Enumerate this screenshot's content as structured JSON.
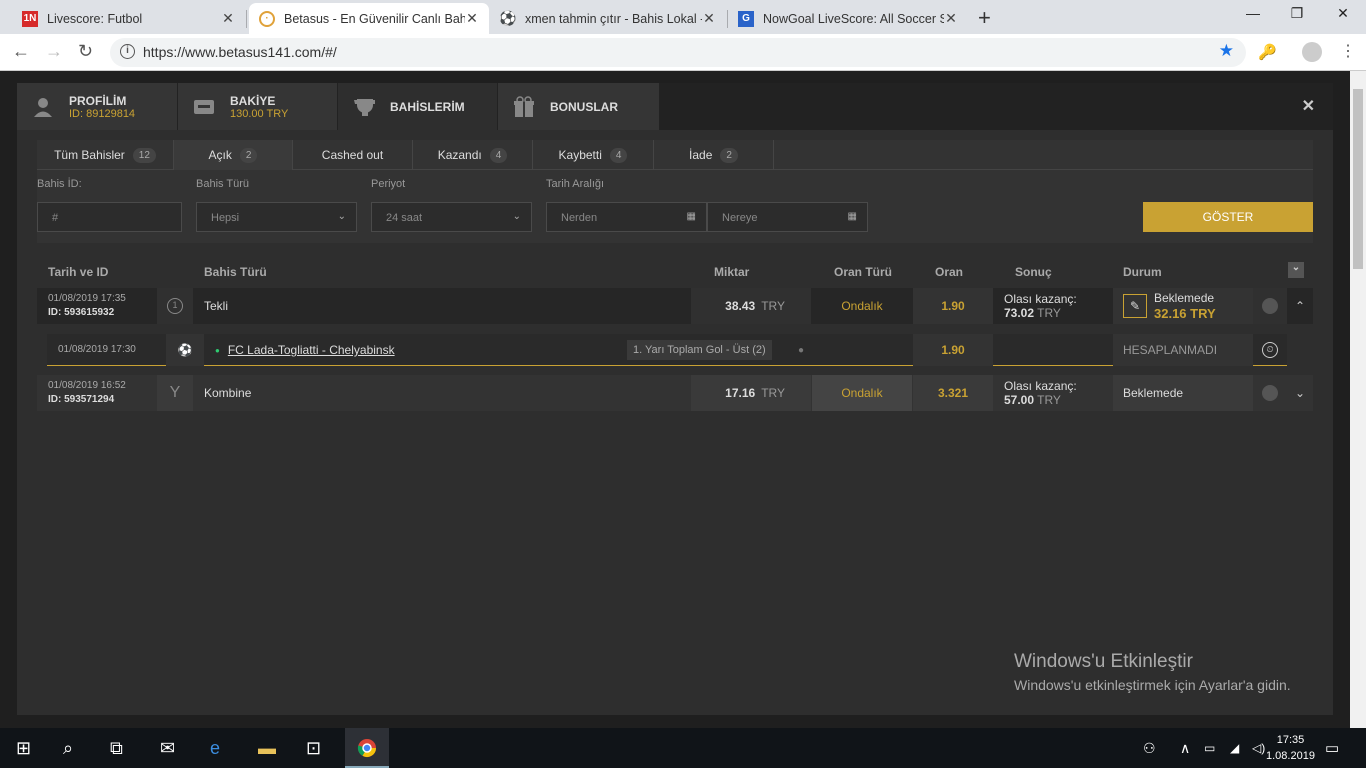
{
  "browser": {
    "tabs": [
      {
        "label": "Livescore: Futbol",
        "icon": "livescore-icon"
      },
      {
        "label": "Betasus - En Güvenilir Canlı Bahis",
        "icon": "betasus-icon",
        "active": true
      },
      {
        "label": "xmen tahmin çıtır - Bahis Lokal -",
        "icon": "soccer-ball-icon"
      },
      {
        "label": "NowGoal LiveScore: All Soccer Sc",
        "icon": "google-icon"
      }
    ],
    "url": "https://www.betasus141.com/#/"
  },
  "modal": {
    "tabs": [
      {
        "label": "PROFİLİM",
        "sub": "ID: 89129814"
      },
      {
        "label": "BAKİYE",
        "sub": "130.00 TRY"
      },
      {
        "label": "BAHİSLERİM",
        "sub": ""
      },
      {
        "label": "BONUSLAR",
        "sub": ""
      }
    ]
  },
  "filters": {
    "tabs": [
      {
        "label": "Tüm Bahisler",
        "count": "12"
      },
      {
        "label": "Açık",
        "count": "2"
      },
      {
        "label": "Cashed out",
        "count": ""
      },
      {
        "label": "Kazandı",
        "count": "4"
      },
      {
        "label": "Kaybetti",
        "count": "4"
      },
      {
        "label": "İade",
        "count": "2"
      }
    ],
    "bet_id_label": "Bahis İD:",
    "bet_id_placeholder": "#",
    "bet_type_label": "Bahis Türü",
    "bet_type_value": "Hepsi",
    "period_label": "Periyot",
    "period_value": "24 saat",
    "date_label": "Tarih Aralığı",
    "from_placeholder": "Nerden",
    "to_placeholder": "Nereye",
    "show_button": "GÖSTER"
  },
  "table": {
    "headers": [
      "Tarih ve ID",
      "Bahis Türü",
      "Miktar",
      "Oran Türü",
      "Oran",
      "Sonuç",
      "Durum"
    ],
    "rows": [
      {
        "date": "01/08/2019 17:35",
        "id": "ID: 593615932",
        "type": "Tekli",
        "amount": "38.43",
        "currency": "TRY",
        "odds_type": "Ondalık",
        "odds": "1.90",
        "possible_label": "Olası kazanç:",
        "possible": "73.02",
        "possible_cur": "TRY",
        "status": "Beklemede",
        "cashout": "32.16 TRY"
      },
      {
        "date": "01/08/2019 16:52",
        "id": "ID: 593571294",
        "type": "Kombine",
        "amount": "17.16",
        "currency": "TRY",
        "odds_type": "Ondalık",
        "odds": "3.321",
        "possible_label": "Olası kazanç:",
        "possible": "57.00",
        "possible_cur": "TRY",
        "status": "Beklemede"
      }
    ],
    "detail": {
      "date": "01/08/2019 17:30",
      "match": "FC Lada-Togliatti - Chelyabinsk",
      "market": "1. Yarı Toplam Gol - Üst (2)",
      "odds": "1.90",
      "status": "HESAPLANMADI"
    }
  },
  "watermark": {
    "title": "Windows'u Etkinleştir",
    "subtitle": "Windows'u etkinleştirmek için Ayarlar'a gidin."
  },
  "taskbar": {
    "time": "17:35",
    "date": "1.08.2019"
  }
}
